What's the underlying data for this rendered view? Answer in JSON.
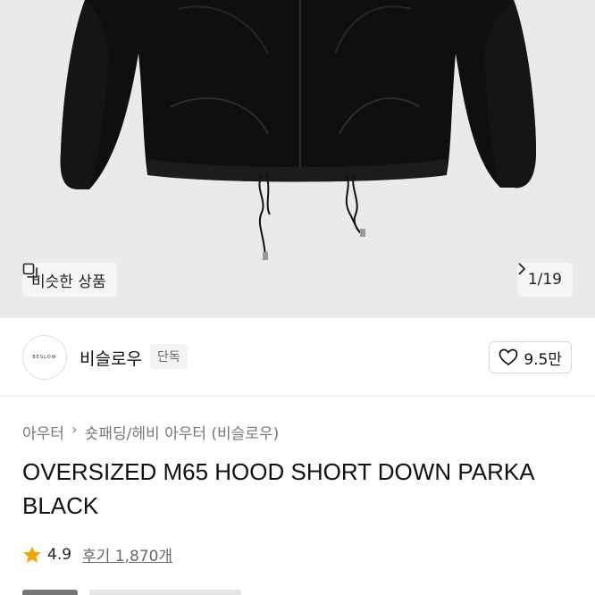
{
  "gallery": {
    "similar_label": "비슷한 상품",
    "counter": "1/19",
    "image_icon": "jacket-photo"
  },
  "brand": {
    "logo_text": "BESLOW",
    "name": "비슬로우",
    "badge": "단독",
    "likes": "9.5만"
  },
  "breadcrumb": [
    "아우터",
    "숏패딩/헤비 아우터 (비슬로우)"
  ],
  "product": {
    "title": "OVERSIZED M65 HOOD SHORT DOWN PARKA BLACK",
    "rating": "4.9",
    "reviews": "후기 1,870개"
  }
}
